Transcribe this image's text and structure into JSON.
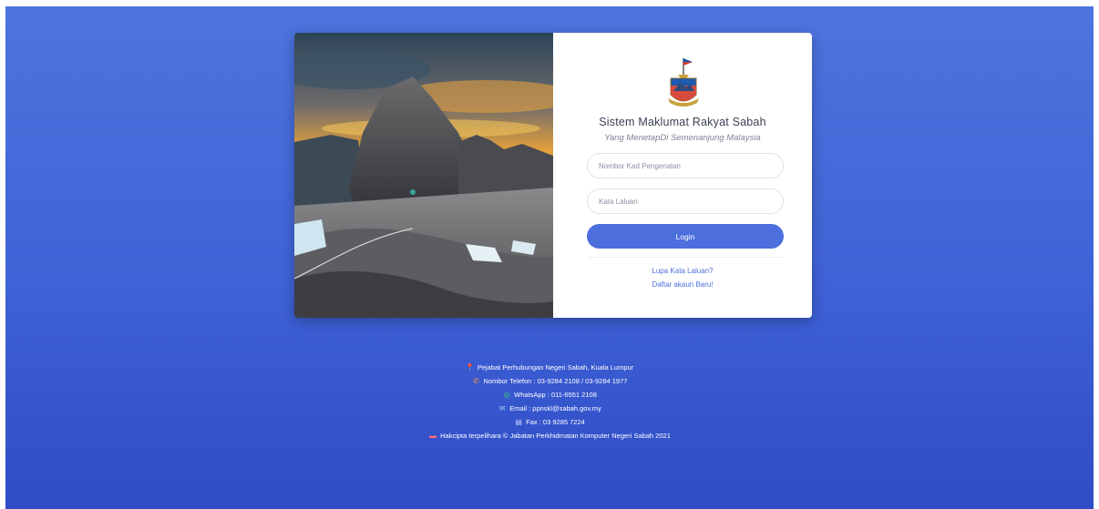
{
  "login_panel": {
    "title": "Sistem Maklumat Rakyat Sabah",
    "subtitle": "Yang MenetapDi Semenanjung Malaysia",
    "id_placeholder": "Nombor Kad Pengenalan",
    "password_placeholder": "Kata Laluan",
    "login_label": "Login",
    "forgot_link": "Lupa Kata Laluan?",
    "register_link": "Daftar akaun Baru!"
  },
  "footer": {
    "address": "Pejabat Perhubungan Negeri Sabah, Kuala Lumpur",
    "phone": "Nombor Telefon : 03-9284 2108 / 03-9284 1977",
    "whatsapp": "WhatsApp : 011-6551 2108",
    "email": "Email : ppnskl@sabah.gov.my",
    "fax": "Fax : 03 9285 7224",
    "copyright": "Hakcipta terpelihara © Jabatan Perkhidmatan Komputer Negeri Sabah 2021"
  },
  "colors": {
    "background": "#4268d9",
    "accent": "#4c6fdd",
    "panel": "#ffffff"
  },
  "icons": {
    "address": "map-pin-icon",
    "phone": "phone-icon",
    "whatsapp": "whatsapp-icon",
    "email": "envelope-icon",
    "fax": "fax-icon",
    "copyright": "book-icon"
  }
}
